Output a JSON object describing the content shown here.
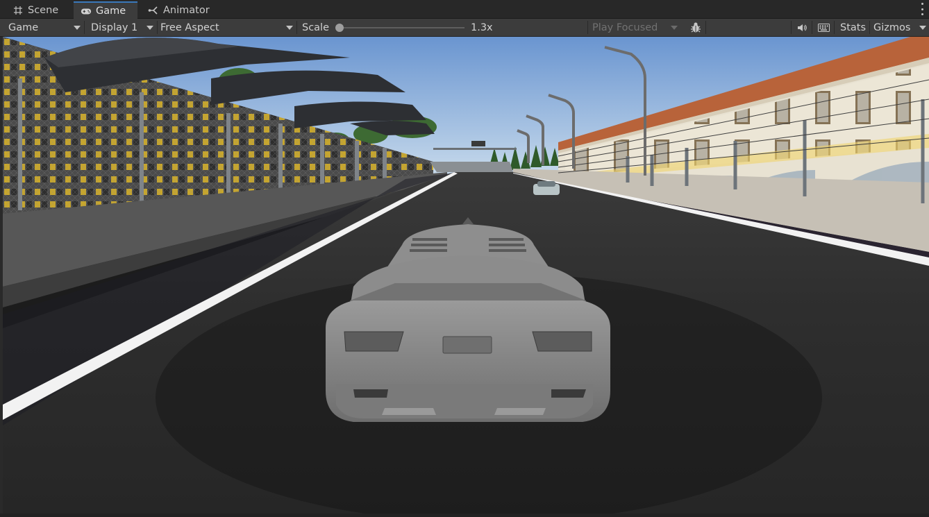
{
  "tabs": [
    {
      "label": "Scene",
      "icon": "grid-icon"
    },
    {
      "label": "Game",
      "icon": "gamepad-icon",
      "active": true
    },
    {
      "label": "Animator",
      "icon": "animator-icon"
    }
  ],
  "toolbar": {
    "view_mode": "Game",
    "display": "Display 1",
    "aspect": "Free Aspect",
    "scale_label": "Scale",
    "scale_value": "1.3x",
    "scale_fraction": 0.0,
    "play_mode": "Play Focused",
    "stats_label": "Stats",
    "gizmos_label": "Gizmos"
  },
  "icons": {
    "bug": "bug-icon",
    "mute": "speaker-icon",
    "keyboard": "keyboard-icon",
    "menu": "kebab-menu-icon"
  },
  "colors": {
    "tab_bar": "#282828",
    "toolbar": "#3c3c3c",
    "active_tab_accent": "#3a79bb",
    "sky_top": "#6a95d0",
    "sky_horizon": "#d6e4ef",
    "asphalt": "#2b2b2b",
    "car_body": "#8a8a8a",
    "roof_tile": "#b8633a"
  }
}
